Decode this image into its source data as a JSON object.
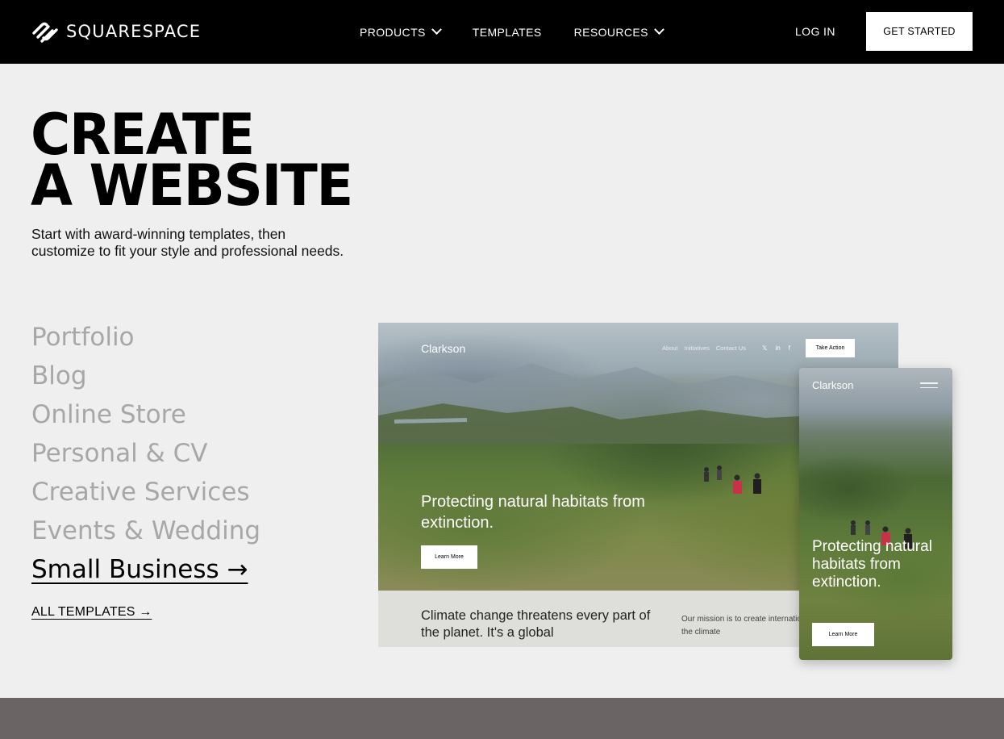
{
  "nav": {
    "brand": "SQUARESPACE",
    "items": [
      {
        "label": "PRODUCTS",
        "has_dropdown": true
      },
      {
        "label": "TEMPLATES",
        "has_dropdown": false
      },
      {
        "label": "RESOURCES",
        "has_dropdown": true
      }
    ],
    "login": "LOG IN",
    "cta": "GET STARTED"
  },
  "hero": {
    "title_line1": "CREATE",
    "title_line2": "A WEBSITE",
    "subtitle_line1": "Start with award-winning templates, then",
    "subtitle_line2": "customize to fit your style and professional needs."
  },
  "categories": {
    "items": [
      {
        "label": "Portfolio",
        "active": false
      },
      {
        "label": "Blog",
        "active": false
      },
      {
        "label": "Online Store",
        "active": false
      },
      {
        "label": "Personal & CV",
        "active": false
      },
      {
        "label": "Creative Services",
        "active": false
      },
      {
        "label": "Events & Wedding",
        "active": false
      },
      {
        "label": "Small Business →",
        "active": true
      }
    ],
    "all_templates": "ALL TEMPLATES →"
  },
  "preview": {
    "desktop": {
      "brand": "Clarkson",
      "links": [
        "About",
        "Initiatives",
        "Contact Us"
      ],
      "social": [
        "𝕏",
        "in",
        "f"
      ],
      "cta": "Take Action",
      "headline": "Protecting natural habitats from extinction.",
      "button": "Learn More",
      "bottom_big": "Climate change threatens every part of the planet. It's a global",
      "bottom_small": "Our mission is to create international consensus around the climate"
    },
    "mobile": {
      "brand": "Clarkson",
      "headline": "Protecting natural habitats from extinction.",
      "button": "Learn More"
    }
  },
  "colors": {
    "nav_bg": "#000000",
    "page_bg": "#efefef",
    "inactive_category": "#a7a7a7",
    "footer_band": "#6a6564"
  }
}
